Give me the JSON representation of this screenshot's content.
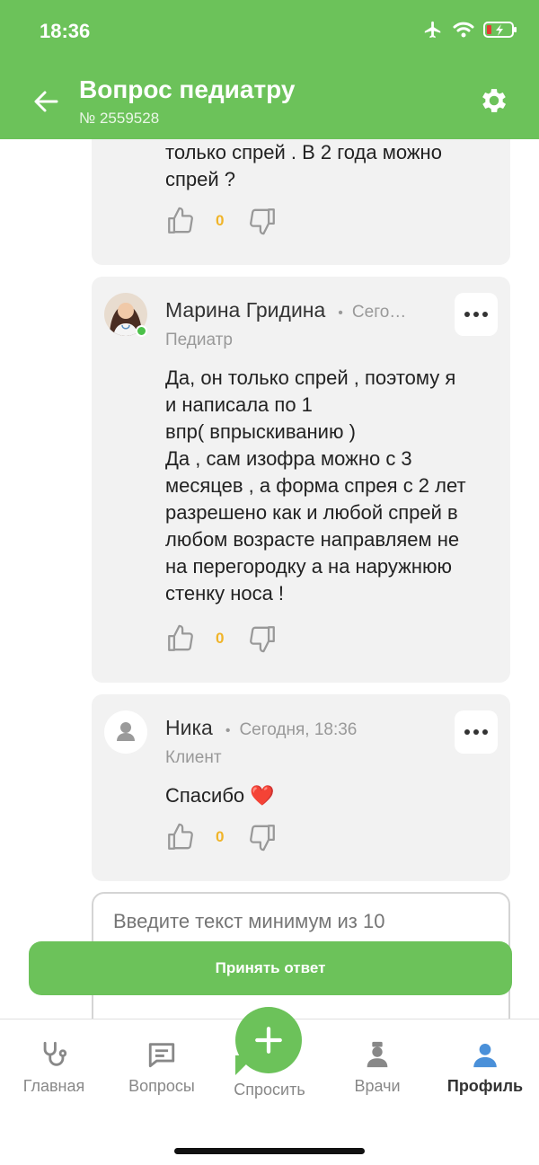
{
  "status_bar": {
    "time": "18:36"
  },
  "header": {
    "title": "Вопрос педиатру",
    "subtitle": "№ 2559528",
    "color": "#6cc25a"
  },
  "prev_message": {
    "text": "только спрей . В 2 года можно\nспрей ?",
    "likes": "0"
  },
  "messages": [
    {
      "author": "Марина Гридина",
      "time": "Сего…",
      "role": "Педиатр",
      "text": "Да, он только спрей , поэтому я\nи написала по 1\nвпр( впрыскиванию )\nДа , сам изофра можно с 3\nмесяцев , а форма спрея с 2 лет\nразрешено как и любой спрей в\nлюбом возрасте направляем не\nна перегородку а на наружнюю\nстенку носа !",
      "likes": "0"
    },
    {
      "author": "Ника",
      "time": "Сегодня, 18:36",
      "role": "Клиент",
      "text": "Спасибо ❤️",
      "likes": "0"
    }
  ],
  "compose": {
    "placeholder": "Введите текст минимум из 10"
  },
  "accept_button": "Принять ответ",
  "tabs": [
    {
      "label": "Главная",
      "icon": "stethoscope-icon"
    },
    {
      "label": "Вопросы",
      "icon": "chat-icon"
    },
    {
      "label": "Спросить",
      "icon": "plus-icon"
    },
    {
      "label": "Врачи",
      "icon": "doctor-icon"
    },
    {
      "label": "Профиль",
      "icon": "profile-icon",
      "active": true
    }
  ]
}
